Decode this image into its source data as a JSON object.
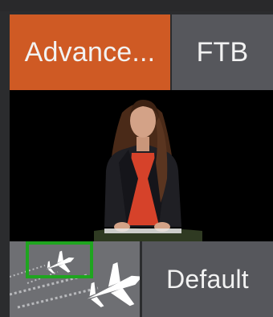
{
  "buttons": {
    "advanced_label": "Advance...",
    "ftb_label": "FTB",
    "default_label": "Default"
  },
  "transition": {
    "icon_name": "jet-fighter-transition-icon",
    "selection_box_color": "#1fa51f"
  },
  "colors": {
    "advanced_accent": "#cf5a24",
    "button_gray": "#56575c",
    "background": "#2b2c2e"
  }
}
